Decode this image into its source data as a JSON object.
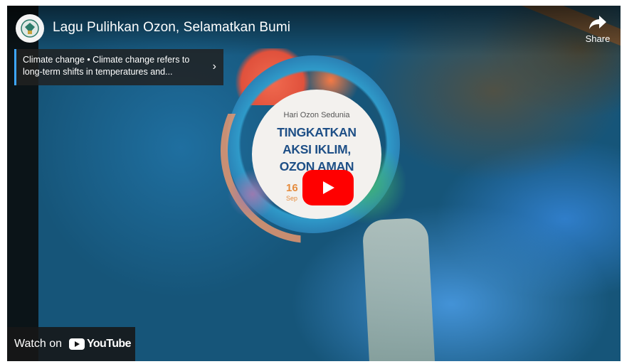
{
  "video": {
    "title": "Lagu Pulihkan Ozon, Selamatkan Bumi",
    "share_label": "Share"
  },
  "info_panel": {
    "text": "Climate change • Climate change refers to long-term shifts in temperatures and...",
    "chevron": "›"
  },
  "thumbnail": {
    "subtitle": "Hari Ozon Sedunia",
    "headline_line1": "TINGKATKAN",
    "headline_line2": "AKSI IKLIM,",
    "headline_line3": "OZON AMAN",
    "date_day": "16",
    "date_month": "Sep"
  },
  "watch_on": {
    "label": "Watch on",
    "brand": "YouTube"
  },
  "icons": {
    "channel": "government-emblem-icon",
    "share": "share-arrow-icon",
    "play": "play-icon",
    "youtube": "youtube-logo-icon"
  },
  "colors": {
    "play_button": "#ff0000",
    "panel_accent": "#3ea6ff",
    "headline": "#1e4f86"
  }
}
